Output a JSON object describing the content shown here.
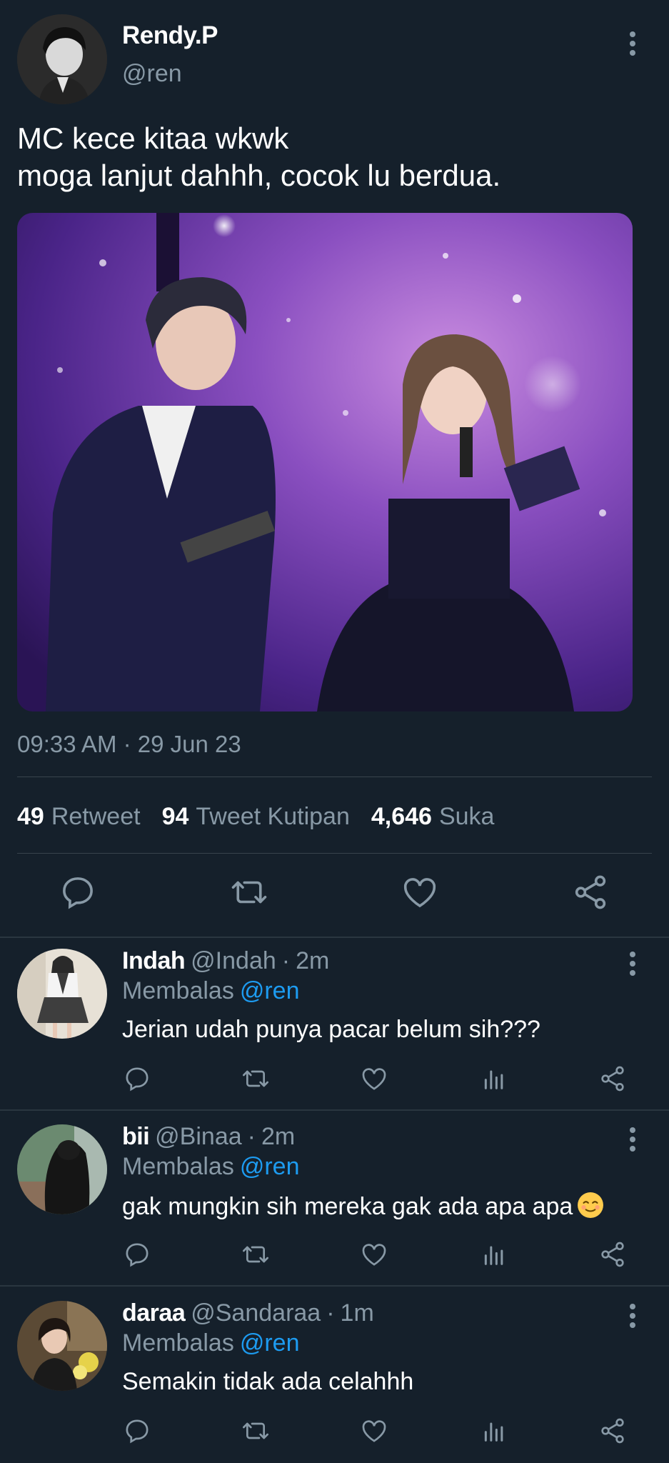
{
  "tweet": {
    "name": "Rendy.P",
    "handle": "@ren",
    "text": "MC kece kitaa wkwk\nmoga lanjut dahhh, cocok lu berdua.",
    "timestamp": "09:33 AM · 29 Jun 23",
    "stats": {
      "retweet_count": "49",
      "retweet_label": "Retweet",
      "quote_count": "94",
      "quote_label": "Tweet Kutipan",
      "like_count": "4,646",
      "like_label": "Suka"
    },
    "actions": [
      "reply-icon",
      "retweet-icon",
      "like-icon",
      "share-icon"
    ]
  },
  "replies": [
    {
      "name": "Indah",
      "handle": "@Indah",
      "time": "2m",
      "replying_prefix": "Membalas",
      "replying_to": "@ren",
      "text": "Jerian udah punya pacar belum sih???"
    },
    {
      "name": "bii",
      "handle": "@Binaa",
      "time": "2m",
      "replying_prefix": "Membalas",
      "replying_to": "@ren",
      "text": "gak mungkin sih mereka gak ada apa apa"
    },
    {
      "name": "daraa",
      "handle": "@Sandaraa",
      "time": "1m",
      "replying_prefix": "Membalas",
      "replying_to": "@ren",
      "text": "Semakin tidak ada celahhh"
    }
  ],
  "colors": {
    "background": "#15202b",
    "secondary_text": "#8899a6",
    "mention": "#1d9bf0",
    "divider": "#38444d"
  }
}
